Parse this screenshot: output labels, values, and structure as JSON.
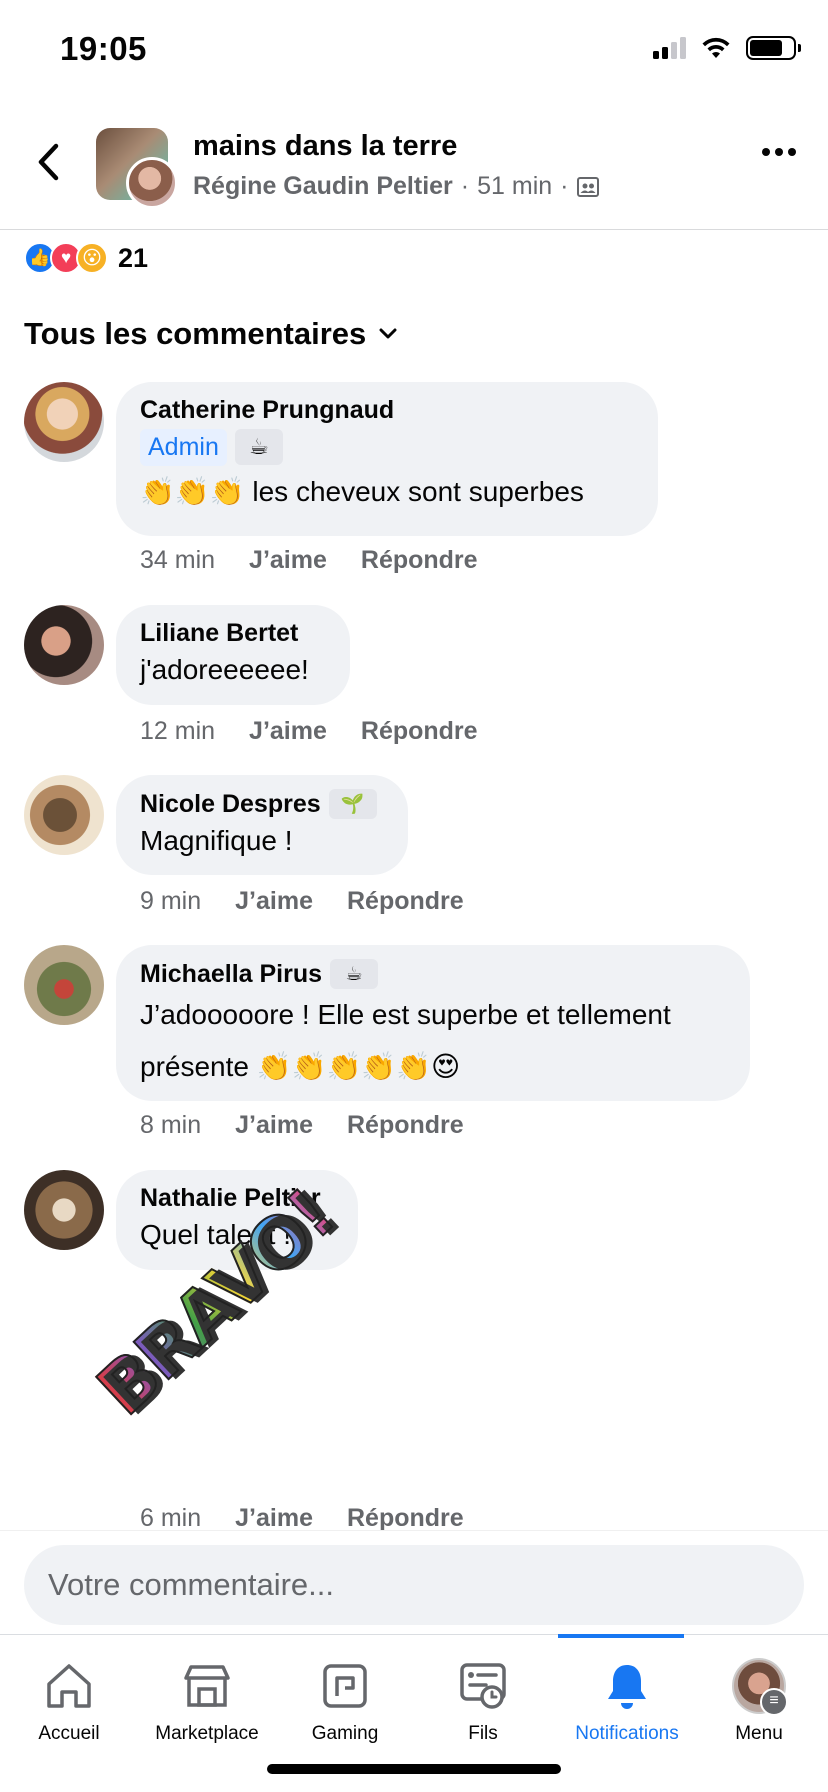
{
  "status_bar": {
    "time": "19:05"
  },
  "header": {
    "group_name": "mains dans la terre",
    "author": "Régine Gaudin Peltier",
    "time": "51 min",
    "separator": "·"
  },
  "reactions": {
    "count": "21",
    "types": [
      "like",
      "love",
      "wow"
    ]
  },
  "filter": {
    "label": "Tous les commentaires"
  },
  "comments": [
    {
      "name": "Catherine Prungnaud",
      "badge": "Admin",
      "badge_icon": "☕",
      "emoji": "👏👏👏",
      "text": "les cheveux sont superbes",
      "time": "34 min",
      "like": "J’aime",
      "reply": "Répondre"
    },
    {
      "name": "Liliane Bertet",
      "text": "j'adoreeeeee!",
      "time": "12 min",
      "like": "J’aime",
      "reply": "Répondre"
    },
    {
      "name": "Nicole Despres",
      "badge_icon": "🌱",
      "text": "Magnifique !",
      "time": "9 min",
      "like": "J’aime",
      "reply": "Répondre"
    },
    {
      "name": "Michaella Pirus",
      "badge_icon": "☕",
      "text_line1": "J’adooooore ! Elle est superbe et tellement",
      "text_line2": "présente 👏👏👏👏👏😍",
      "time": "8 min",
      "like": "J’aime",
      "reply": "Répondre"
    },
    {
      "name": "Nathalie Peltier",
      "text": "Quel talent !",
      "sticker_text": "BRAVO!",
      "time": "6 min",
      "like": "J’aime",
      "reply": "Répondre"
    }
  ],
  "composer": {
    "placeholder": "Votre commentaire..."
  },
  "nav": [
    {
      "label": "Accueil",
      "icon": "home-icon"
    },
    {
      "label": "Marketplace",
      "icon": "marketplace-icon"
    },
    {
      "label": "Gaming",
      "icon": "gaming-icon"
    },
    {
      "label": "Fils",
      "icon": "feeds-icon"
    },
    {
      "label": "Notifications",
      "icon": "bell-icon",
      "active": true
    },
    {
      "label": "Menu",
      "icon": "profile-menu-icon"
    }
  ],
  "colors": {
    "accent": "#1877f2",
    "bubble": "#f0f2f5",
    "secondary_text": "#65676b"
  }
}
